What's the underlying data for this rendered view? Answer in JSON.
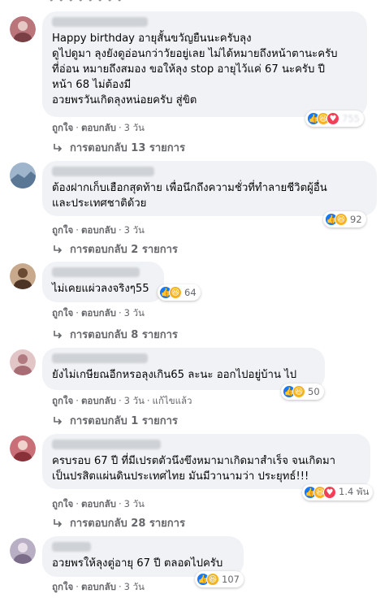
{
  "top_strip": "• • • • • • • •",
  "comments": [
    {
      "text": "Happy birthday อายุสั้นขวัญยืนนะครับลุง\nดูไปดูมา ลุงยังดูอ่อนกว่าวัยอยู่เลย ไม่ได้หมายถึงหน้าตานะครับ\nที่อ่อน หมายถึงสมอง ขอให้ลุง stop อายุไว้แค่ 67 นะครับ ปี\nหน้า 68 ไม่ต้องมี\nอวยพรวันเกิดลุงหน่อยครับ สู่ขิต",
      "reaction_count": "755",
      "like": "ถูกใจ",
      "reply": "ตอบกลับ",
      "time": "3 วัน",
      "replies": "การตอบกลับ 13 รายการ",
      "avatar_color": "#b9757a"
    },
    {
      "text": "ต้องฝากเก็บเฮือกสุดท้าย เพื่อนึกถึงความชั่วที่ทำลายชีวิตผู้อื่น\nและประเทศชาติด้วย",
      "reaction_count": "92",
      "like": "ถูกใจ",
      "reply": "ตอบกลับ",
      "time": "3 วัน",
      "replies": "การตอบกลับ 2 รายการ",
      "avatar_color": "#6f8fb3"
    },
    {
      "text": "ไม่เคยแผ่วลงจริงๆ55",
      "reaction_count": "64",
      "like": "ถูกใจ",
      "reply": "ตอบกลับ",
      "time": "3 วัน",
      "replies": "การตอบกลับ 8 รายการ",
      "avatar_color": "#8a6a4e"
    },
    {
      "text": "ยังไม่เกษียณอีกหรอลุงเกิน65 ละนะ ออกไปอยู่บ้าน ไป",
      "reaction_count": "50",
      "like": "ถูกใจ",
      "reply": "ตอบกลับ",
      "time": "3 วัน",
      "edited": "แก้ไขแล้ว",
      "replies": "การตอบกลับ 1 รายการ",
      "avatar_color": "#b98a8f"
    },
    {
      "text": "ครบรอบ 67 ปี ที่มีเปรตตัวนึงขึงหมามาเกิดมาสำเร็จ จนเกิดมา\nเป็นปรสิตแผ่นดินประเทศไทย มันมีวานามว่า ประยุทธ์!!!",
      "reaction_count": "1.4 พัน",
      "like": "ถูกใจ",
      "reply": "ตอบกลับ",
      "time": "3 วัน",
      "replies": "การตอบกลับ 28 รายการ",
      "avatar_color": "#a0525a"
    },
    {
      "text": "อวยพรให้ลุงตู่อายุ 67 ปี ตลอดไปครับ",
      "reaction_count": "107",
      "like": "ถูกใจ",
      "reply": "ตอบกลับ",
      "time": "3 วัน",
      "avatar_color": "#9c8fa8"
    }
  ]
}
